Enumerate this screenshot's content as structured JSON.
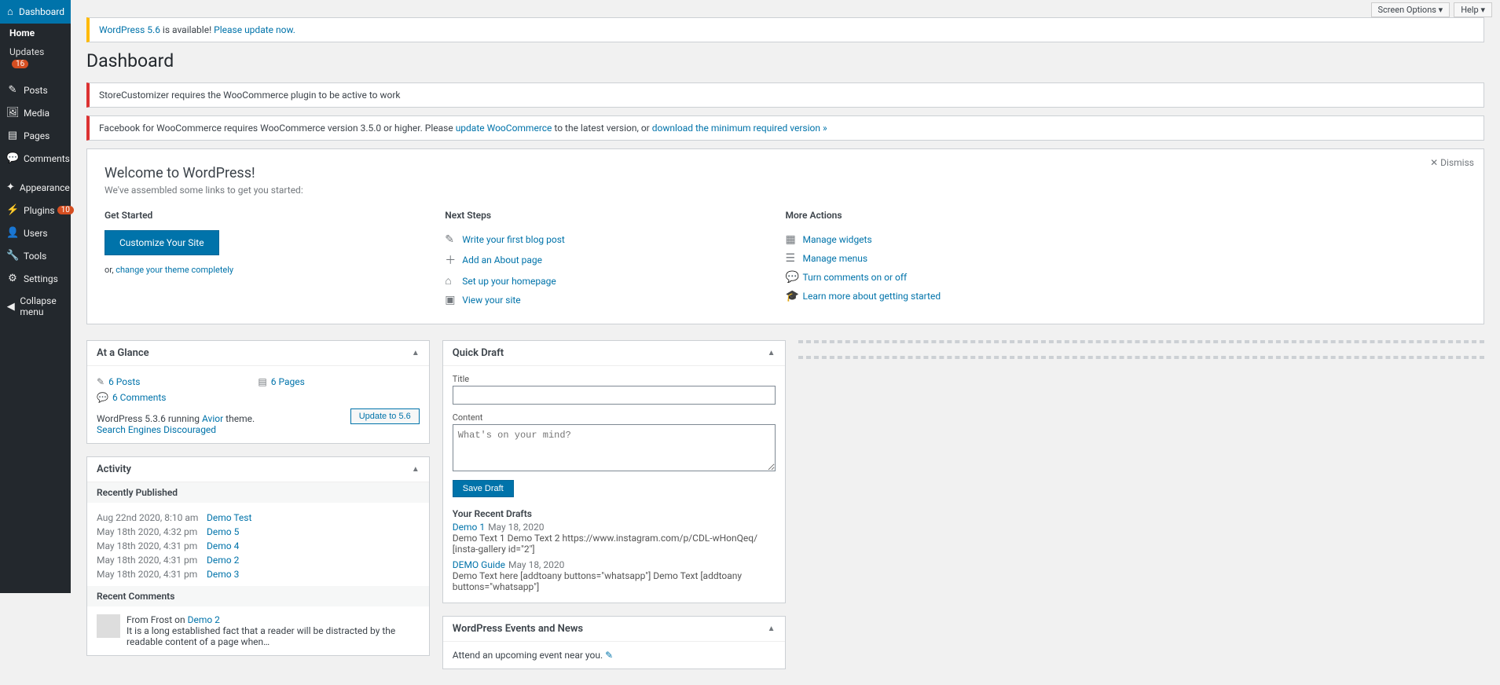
{
  "sidebar": {
    "items": [
      {
        "label": "Dashboard",
        "icon": "⌂",
        "current": true
      },
      {
        "label": "Posts",
        "icon": "✎"
      },
      {
        "label": "Media",
        "icon": "🖼"
      },
      {
        "label": "Pages",
        "icon": "▤"
      },
      {
        "label": "Comments",
        "icon": "💬"
      },
      {
        "label": "Appearance",
        "icon": "✦",
        "sep": true
      },
      {
        "label": "Plugins",
        "icon": "⚡",
        "badge": "10"
      },
      {
        "label": "Users",
        "icon": "👤"
      },
      {
        "label": "Tools",
        "icon": "🔧"
      },
      {
        "label": "Settings",
        "icon": "⚙"
      },
      {
        "label": "Collapse menu",
        "icon": "◀",
        "collapse": true
      }
    ],
    "subs": [
      {
        "label": "Home",
        "current": true
      },
      {
        "label": "Updates",
        "badge": "16"
      }
    ]
  },
  "topbar": {
    "screen": "Screen Options ▾",
    "help": "Help ▾"
  },
  "page_title": "Dashboard",
  "notice_update": {
    "pre": "WordPress 5.6",
    "mid": " is available! ",
    "link": "Please update now."
  },
  "notice_store": "StoreCustomizer requires the WooCommerce plugin to be active to work",
  "notice_fb": {
    "pre": "Facebook for WooCommerce requires WooCommerce version 3.5.0 or higher. Please ",
    "l1": "update WooCommerce",
    "mid": " to the latest version, or ",
    "l2": "download the minimum required version »"
  },
  "welcome": {
    "dismiss": "✕ Dismiss",
    "title": "Welcome to WordPress!",
    "sub": "We've assembled some links to get you started:",
    "col1": {
      "h": "Get Started",
      "btn": "Customize Your Site",
      "or": "or, ",
      "link": "change your theme completely"
    },
    "col2": {
      "h": "Next Steps",
      "items": [
        {
          "ic": "✎",
          "t": "Write your first blog post"
        },
        {
          "ic": "＋",
          "t": "Add an About page"
        },
        {
          "ic": "⌂",
          "t": "Set up your homepage"
        },
        {
          "ic": "▣",
          "t": "View your site"
        }
      ]
    },
    "col3": {
      "h": "More Actions",
      "items": [
        {
          "ic": "▦",
          "t": "Manage widgets"
        },
        {
          "ic": "☰",
          "t": "Manage menus"
        },
        {
          "ic": "💬",
          "t": "Turn comments on or off"
        },
        {
          "ic": "🎓",
          "t": "Learn more about getting started"
        }
      ]
    }
  },
  "glance": {
    "title": "At a Glance",
    "posts": "6 Posts",
    "pages": "6 Pages",
    "comments": "6 Comments",
    "running_pre": "WordPress 5.3.6 running ",
    "theme": "Avior",
    "running_post": " theme.",
    "search": "Search Engines Discouraged",
    "update_btn": "Update to 5.6"
  },
  "activity": {
    "title": "Activity",
    "pub_h": "Recently Published",
    "items": [
      {
        "d": "Aug 22nd 2020, 8:10 am",
        "t": "Demo Test"
      },
      {
        "d": "May 18th 2020, 4:32 pm",
        "t": "Demo 5"
      },
      {
        "d": "May 18th 2020, 4:31 pm",
        "t": "Demo 4"
      },
      {
        "d": "May 18th 2020, 4:31 pm",
        "t": "Demo 2"
      },
      {
        "d": "May 18th 2020, 4:31 pm",
        "t": "Demo 3"
      }
    ],
    "com_h": "Recent Comments",
    "com_from": "From Frost on ",
    "com_post": "Demo 2",
    "com_text": "It is a long established fact that a reader will be distracted by the readable content of a page when…"
  },
  "draft": {
    "title": "Quick Draft",
    "l_title": "Title",
    "l_content": "Content",
    "ph": "What's on your mind?",
    "save": "Save Draft",
    "recent_h": "Your Recent Drafts",
    "items": [
      {
        "t": "Demo 1",
        "d": "May 18, 2020",
        "ex": "Demo Text 1 Demo Text 2 https://www.instagram.com/p/CDL-wHonQeq/ [insta-gallery id=\"2\"]"
      },
      {
        "t": "DEMO Guide",
        "d": "May 18, 2020",
        "ex": "Demo Text here [addtoany buttons=\"whatsapp\"] Demo Text [addtoany buttons=\"whatsapp\"]"
      }
    ]
  },
  "events": {
    "title": "WordPress Events and News",
    "attend": "Attend an upcoming event near you.",
    "ic": "✎"
  }
}
